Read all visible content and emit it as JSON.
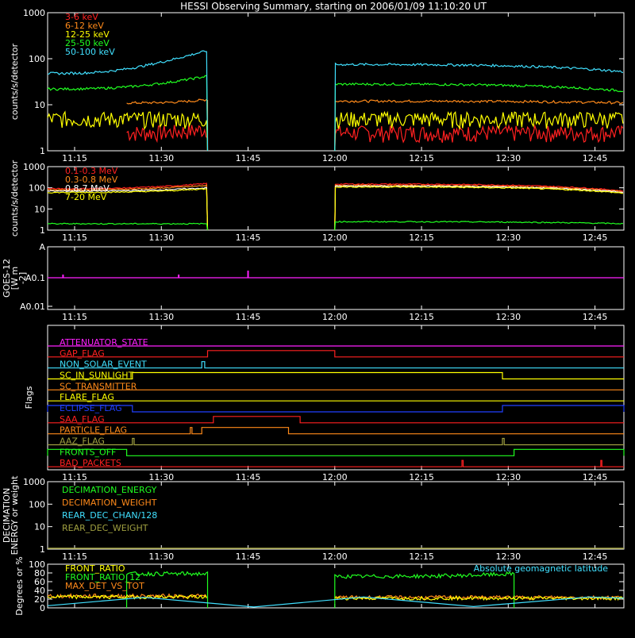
{
  "title": "HESSI Observing Summary, starting on 2006/01/09 11:10:20 UT",
  "colors": {
    "background": "#000000",
    "axes": "#ffffff",
    "red": "#ff2020",
    "orange": "#ff8a1a",
    "yellow": "#ffff00",
    "green": "#20ff20",
    "cyan": "#40e0ff",
    "magenta": "#ff20ff",
    "blue": "#2040ff",
    "olive": "#a0a040",
    "brown": "#e06030"
  },
  "time_ticks": [
    "11:15",
    "11:30",
    "11:45",
    "12:00",
    "12:15",
    "12:30",
    "12:45"
  ],
  "chart_data": [
    {
      "type": "line",
      "panel": "lo-energy",
      "ylabel": "counts/s/detector",
      "yscale": "log",
      "ylim": [
        1,
        1000
      ],
      "yticks": [
        "1000",
        "100",
        "10",
        "1"
      ],
      "xrange": [
        "11:10:20",
        "12:50"
      ],
      "gaps": [
        [
          "11:38",
          "12:00"
        ]
      ],
      "series": [
        {
          "name": "3-6 keV",
          "color": "#ff2020",
          "before": [
            2.5,
            3.0
          ],
          "after": [
            2.5,
            2.5
          ],
          "noisy": true,
          "start": "11:24"
        },
        {
          "name": "6-12 keV",
          "color": "#ff8a1a",
          "before": [
            11,
            13
          ],
          "after": [
            12,
            11
          ],
          "start": "11:24"
        },
        {
          "name": "12-25 keV",
          "color": "#ffff00",
          "before": [
            5,
            5
          ],
          "after": [
            5,
            5
          ],
          "noisy": true
        },
        {
          "name": "25-50 keV",
          "color": "#20ff20",
          "before": [
            22,
            42
          ],
          "after": [
            28,
            20
          ]
        },
        {
          "name": "50-100 keV",
          "color": "#40e0ff",
          "before": [
            48,
            150
          ],
          "after": [
            75,
            52
          ]
        }
      ]
    },
    {
      "type": "line",
      "panel": "hi-energy",
      "ylabel": "counts/s/detector",
      "yscale": "log",
      "ylim": [
        1,
        1000
      ],
      "yticks": [
        "1000",
        "100",
        "10",
        "1"
      ],
      "series": [
        {
          "name": "0.1-0.3 MeV",
          "color": "#ff2020",
          "before": [
            90,
            160
          ],
          "after": [
            150,
            70
          ]
        },
        {
          "name": "0.3-0.8 MeV",
          "color": "#ff8a1a",
          "before": [
            80,
            130
          ],
          "after": [
            130,
            65
          ]
        },
        {
          "name": "0.8-7 MeV",
          "color": "#ffffff",
          "before": [
            70,
            100
          ],
          "after": [
            120,
            60
          ]
        },
        {
          "name": "7-20 MeV",
          "color": "#ffff00",
          "before": [
            60,
            90
          ],
          "after": [
            110,
            55
          ]
        },
        {
          "name": "",
          "color": "#20ff20",
          "before": [
            2,
            2
          ],
          "after": [
            2.5,
            2
          ]
        }
      ]
    },
    {
      "type": "line",
      "panel": "goes",
      "ylabel": "GOES-12 [W m^-2]",
      "ylabel_lines": [
        "GOES-12",
        "[W m",
        "-2]"
      ],
      "yticks": [
        "A",
        "A0.1",
        "A0.01"
      ],
      "series": [
        {
          "name": "GOES-12",
          "color": "#ff20ff",
          "level": "A0.1"
        }
      ],
      "spikes": [
        "11:13",
        "11:33",
        "11:45"
      ]
    },
    {
      "type": "table",
      "panel": "flags",
      "ylabel": "Flags",
      "flags": [
        {
          "name": "ATTENUATOR_STATE",
          "color": "#ff20ff",
          "on": []
        },
        {
          "name": "GAP_FLAG",
          "color": "#ff2020",
          "on": [
            [
              "11:38",
              "12:00"
            ]
          ]
        },
        {
          "name": "NON_SOLAR_EVENT",
          "color": "#40e0ff",
          "on": [
            [
              "11:37",
              "11:37.5"
            ]
          ]
        },
        {
          "name": "SC_IN_SUNLIGHT",
          "color": "#ffff00",
          "on": [
            [
              "11:25",
              "12:29"
            ]
          ]
        },
        {
          "name": "SC_TRANSMITTER",
          "color": "#ff8a1a",
          "on": []
        },
        {
          "name": "FLARE_FLAG",
          "color": "#ffff00",
          "on": []
        },
        {
          "name": "ECLIPSE_FLAG",
          "color": "#2040ff",
          "on": [
            [
              "11:10:20",
              "11:25"
            ],
            [
              "12:29",
              "12:50"
            ]
          ]
        },
        {
          "name": "SAA_FLAG",
          "color": "#ff2020",
          "on": [
            [
              "11:39",
              "11:54"
            ]
          ]
        },
        {
          "name": "PARTICLE_FLAG",
          "color": "#ff8a1a",
          "on": [
            [
              "11:35",
              "11:35.3"
            ],
            [
              "11:37",
              "11:52"
            ]
          ]
        },
        {
          "name": "AAZ_FLAG",
          "color": "#a0a040",
          "on": [
            [
              "11:25",
              "11:25.3"
            ],
            [
              "12:29",
              "12:29.3"
            ]
          ]
        },
        {
          "name": "FRONTS_OFF",
          "color": "#20ff20",
          "on": [
            [
              "11:10:20",
              "11:24"
            ],
            [
              "12:31",
              "12:50"
            ]
          ]
        },
        {
          "name": "BAD_PACKETS",
          "color": "#ff2020",
          "on": [
            [
              "12:22",
              "12:22.2"
            ],
            [
              "12:46",
              "12:46.2"
            ]
          ]
        }
      ]
    },
    {
      "type": "line",
      "panel": "decimation",
      "ylabel": "DECIMATION ENERGY or weight",
      "ylabel_lines": [
        "DECIMATION",
        "ENERGY or weight"
      ],
      "yscale": "log",
      "ylim": [
        1,
        1000
      ],
      "yticks": [
        "1000",
        "100",
        "10",
        "1"
      ],
      "series": [
        {
          "name": "DECIMATION_ENERGY",
          "color": "#20ff20"
        },
        {
          "name": "DECIMATION_WEIGHT",
          "color": "#ff8a1a"
        },
        {
          "name": "REAR_DEC_CHAN/128",
          "color": "#40e0ff"
        },
        {
          "name": "REAR_DEC_WEIGHT",
          "color": "#a0a040"
        }
      ],
      "flat_value": 1
    },
    {
      "type": "line",
      "panel": "ratios",
      "ylabel": "Degrees or %",
      "ylim": [
        0,
        100
      ],
      "yticks": [
        "100",
        "80",
        "60",
        "40",
        "20",
        "0"
      ],
      "annotation": "Absolute geomagnetic latitude",
      "series": [
        {
          "name": "FRONT_RATIO",
          "color": "#ffff00",
          "level": 25
        },
        {
          "name": "FRONT_RATIO_12",
          "color": "#20ff20",
          "level": 78
        },
        {
          "name": "MAX_DET_VS_TOT",
          "color": "#ff8a1a",
          "level": 27
        }
      ],
      "geomag_latitude": {
        "color": "#40e0ff",
        "points": [
          [
            "11:10:20",
            5
          ],
          [
            "11:27",
            24
          ],
          [
            "11:46",
            2
          ],
          [
            "12:05",
            25
          ],
          [
            "12:24",
            3
          ],
          [
            "12:44",
            25
          ],
          [
            "12:50",
            22
          ]
        ]
      }
    }
  ]
}
